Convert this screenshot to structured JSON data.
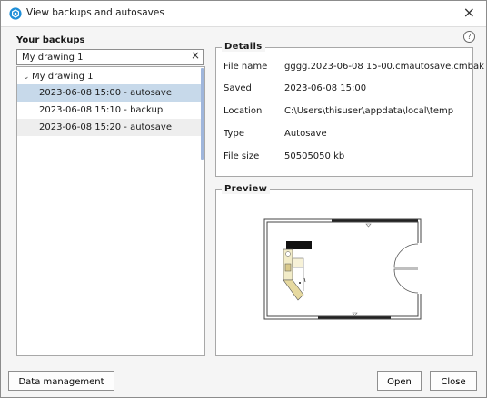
{
  "window": {
    "title": "View backups and autosaves",
    "close_glyph": "×",
    "help_glyph": "?",
    "accent": "#1f8fd8"
  },
  "backups": {
    "heading": "Your backups",
    "search_value": "My drawing 1",
    "clear_glyph": "×",
    "tree": {
      "parent_chevron": "⌄",
      "parent_label": "My drawing 1",
      "items": [
        {
          "label": "2023-06-08 15:00 - autosave",
          "state": "selected"
        },
        {
          "label": "2023-06-08 15:10 - backup",
          "state": "normal"
        },
        {
          "label": "2023-06-08 15:20 - autosave",
          "state": "alternate"
        }
      ]
    }
  },
  "details": {
    "heading": "Details",
    "rows": [
      {
        "key": "File name",
        "value": "gggg.2023-06-08 15-00.cmautosave.cmbak"
      },
      {
        "key": "Saved",
        "value": "2023-06-08 15:00"
      },
      {
        "key": "Location",
        "value": "C:\\Users\\thisuser\\appdata\\local\\temp"
      },
      {
        "key": "Type",
        "value": "Autosave"
      },
      {
        "key": "File size",
        "value": "50505050 kb"
      }
    ]
  },
  "preview": {
    "heading": "Preview"
  },
  "footer": {
    "data_management_label": "Data management",
    "open_label": "Open",
    "close_label": "Close"
  },
  "colors": {
    "selected_row": "#c7d9ea",
    "alternate_row": "#eeeeee",
    "scroll_thumb": "#9fb6dc"
  }
}
